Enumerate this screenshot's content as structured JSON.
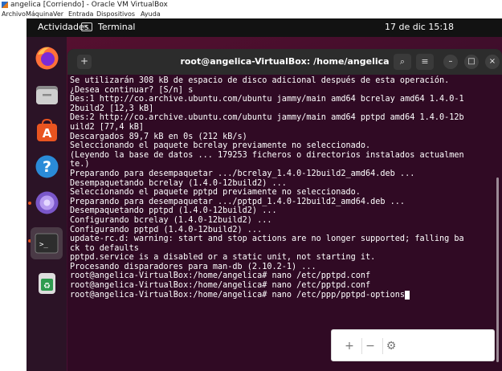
{
  "vbox": {
    "title": "angelica [Corriendo] - Oracle VM VirtualBox",
    "menu": [
      "Archivo",
      "Máquina",
      "Ver",
      "Entrada",
      "Dispositivos",
      "Ayuda"
    ]
  },
  "topbar": {
    "activities": "Actividades",
    "app": "Terminal",
    "clock": "17 de dic  15:18"
  },
  "window": {
    "title": "root@angelica-VirtualBox: /home/angelica"
  },
  "terminal": {
    "lines": [
      "Se utilizarán 308 kB de espacio de disco adicional después de esta operación.",
      "¿Desea continuar? [S/n] s",
      "Des:1 http://co.archive.ubuntu.com/ubuntu jammy/main amd64 bcrelay amd64 1.4.0-1",
      "2build2 [12,3 kB]",
      "Des:2 http://co.archive.ubuntu.com/ubuntu jammy/main amd64 pptpd amd64 1.4.0-12b",
      "uild2 [77,4 kB]",
      "Descargados 89,7 kB en 0s (212 kB/s)",
      "Seleccionando el paquete bcrelay previamente no seleccionado.",
      "(Leyendo la base de datos ... 179253 ficheros o directorios instalados actualmen",
      "te.)",
      "Preparando para desempaquetar .../bcrelay_1.4.0-12build2_amd64.deb ...",
      "Desempaquetando bcrelay (1.4.0-12build2) ...",
      "Seleccionando el paquete pptpd previamente no seleccionado.",
      "Preparando para desempaquetar .../pptpd_1.4.0-12build2_amd64.deb ...",
      "Desempaquetando pptpd (1.4.0-12build2) ...",
      "Configurando bcrelay (1.4.0-12build2) ...",
      "Configurando pptpd (1.4.0-12build2) ...",
      "update-rc.d: warning: start and stop actions are no longer supported; falling ba",
      "ck to defaults",
      "pptpd.service is a disabled or a static unit, not starting it.",
      "Procesando disparadores para man-db (2.10.2-1) ...",
      "root@angelica-VirtualBox:/home/angelica# nano /etc/pptpd.conf",
      "root@angelica-VirtualBox:/home/angelica# nano /etc/pptpd.conf",
      "root@angelica-VirtualBox:/home/angelica# nano /etc/ppp/pptpd-options"
    ]
  },
  "popup": {
    "plus": "+",
    "minus": "−",
    "gear_icon": "gear-icon"
  }
}
